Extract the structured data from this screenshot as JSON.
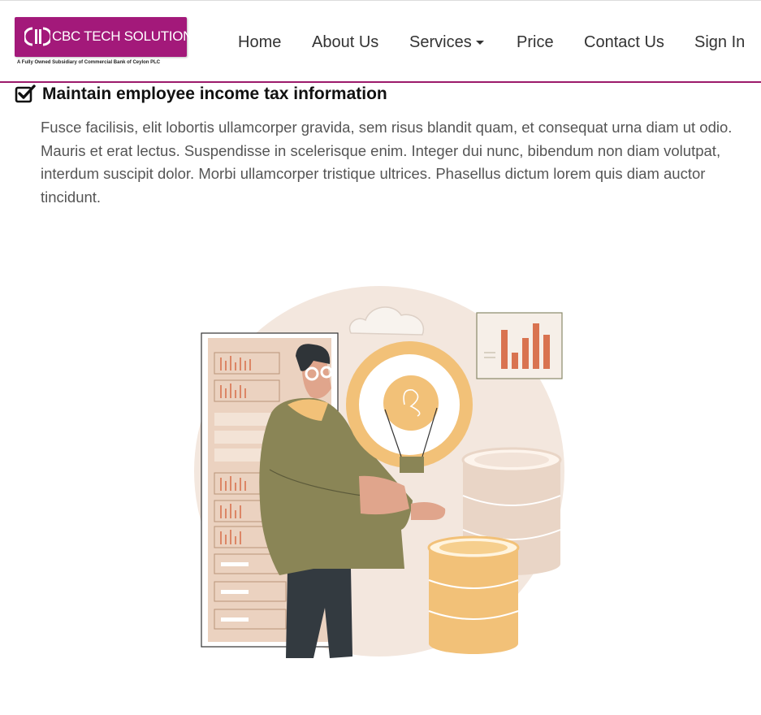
{
  "brand": {
    "name": "CBC TECH SOLUTIONS",
    "tagline": "A Fully Owned Subsidiary of Commercial Bank of Ceylon PLC",
    "color": "#a3197a"
  },
  "nav": {
    "items": [
      {
        "label": "Home"
      },
      {
        "label": "About Us"
      },
      {
        "label": "Services"
      },
      {
        "label": "Price"
      },
      {
        "label": "Contact Us"
      },
      {
        "label": "Sign In"
      }
    ],
    "accent_color": "#9c1a6b"
  },
  "feature": {
    "icon": "checkbox-checked-icon",
    "title": "Maintain employee income tax information",
    "description": "Fusce facilisis, elit lobortis ullamcorper gravida, sem risus blandit quam, et consequat urna diam ut odio. Mauris et erat lectus. Suspendisse in scelerisque enim. Integer dui nunc, bibendum non diam volutpat, interdum suscipit dolor. Morbi ullamcorper tristique ultrices. Phasellus dictum lorem quis diam auctor tincidunt."
  }
}
